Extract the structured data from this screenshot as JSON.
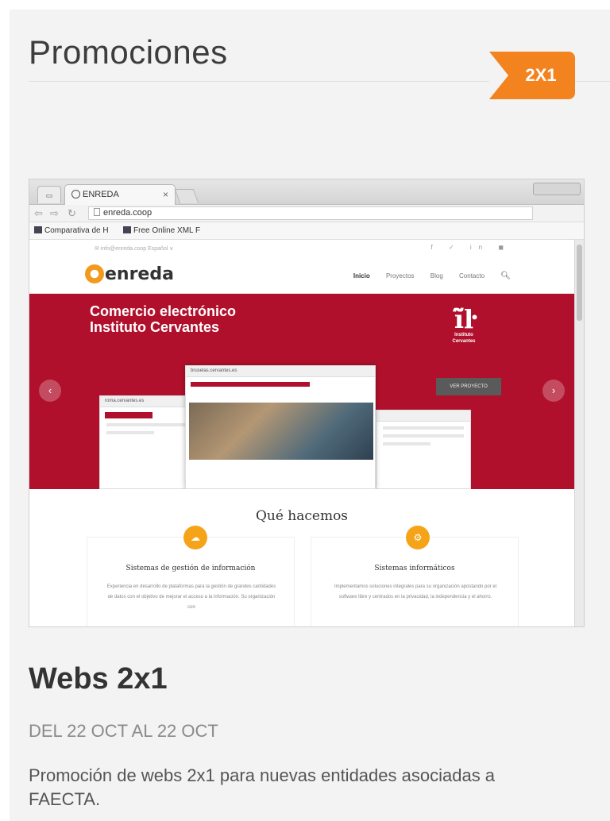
{
  "heading": "Promociones",
  "browser": {
    "tab_title": "ENREDA",
    "tab_close": "×",
    "url": "enreda.coop",
    "bookmarks": [
      "Comparativa de H",
      "Free Online XML F"
    ]
  },
  "site": {
    "email": "✉ info@enreda.coop   Español ∨",
    "social": "f ✓ in ◼",
    "logo": "enreda",
    "menu": [
      "Inicio",
      "Proyectos",
      "Blog",
      "Contacto"
    ],
    "search_icon": "🔍︎",
    "hero_title_line1": "Comercio electrónico",
    "hero_title_line2": "Instituto Cervantes",
    "ic_glyph": "ĩ̃ŀ",
    "ic_text": "Instituto Cervantes",
    "ver_button": "VER PROYECTO",
    "mock_left_url": "roma.cervantes.es",
    "mock_center_url": "bruselas.cervantes.es",
    "section_title": "Qué hacemos",
    "cards": [
      {
        "title": "Sistemas de gestión de información",
        "body": "Experiencia en desarrollo de plataformas para la gestión de grandes cantidades de datos con el objetivo de mejorar el acceso a la información. Su organización con"
      },
      {
        "title": "Sistemas informáticos",
        "body": "Implementamos soluciones integrales para su organización apostando por el software libre y centrados en la privacidad, la independencia y el ahorro."
      }
    ]
  },
  "badge": "2X1",
  "promo": {
    "title": "Webs 2x1",
    "dates": "DEL 22 OCT AL 22 OCT",
    "description": "Promoción de webs 2x1 para nuevas entidades asociadas a FAECTA."
  },
  "colors": {
    "badge": "#f3831f",
    "hero": "#b0102c",
    "panel_bg": "#f3f3f3"
  }
}
